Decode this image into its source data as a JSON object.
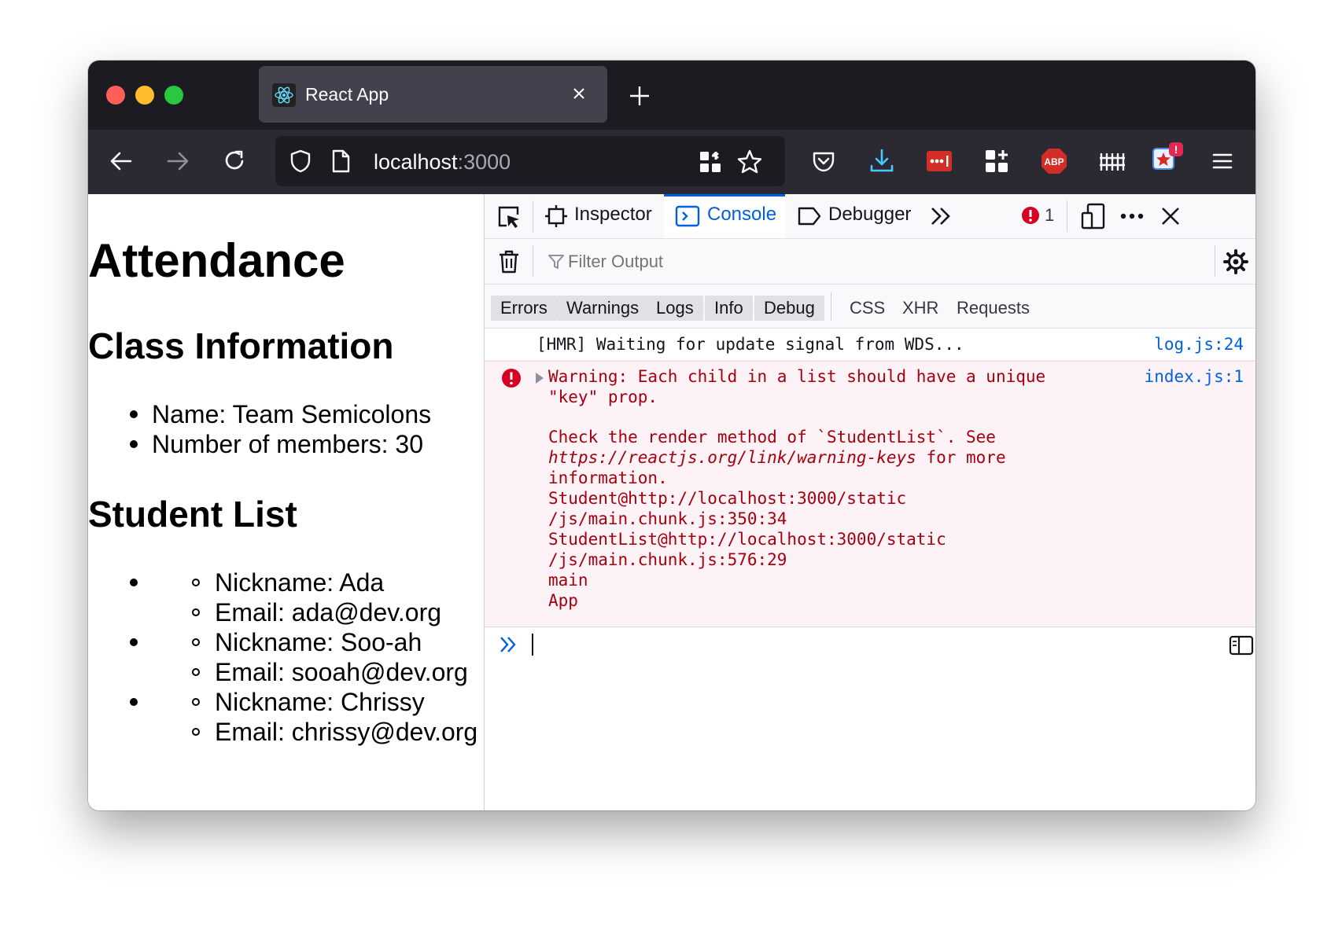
{
  "browser": {
    "tab": {
      "title": "React App"
    },
    "url": {
      "host": "localhost",
      "port": ":3000"
    }
  },
  "page": {
    "heading": "Attendance",
    "class_section": {
      "title": "Class Information",
      "items": [
        "Name: Team Semicolons",
        "Number of members: 30"
      ]
    },
    "students_section": {
      "title": "Student List",
      "students": [
        {
          "nickname": "Nickname: Ada",
          "email": "Email: ada@dev.org"
        },
        {
          "nickname": "Nickname: Soo-ah",
          "email": "Email: sooah@dev.org"
        },
        {
          "nickname": "Nickname: Chrissy",
          "email": "Email: chrissy@dev.org"
        }
      ]
    }
  },
  "devtools": {
    "tabs": {
      "inspector": "Inspector",
      "console": "Console",
      "debugger": "Debugger"
    },
    "error_count": "1",
    "filter_placeholder": "Filter Output",
    "filters": [
      "Errors",
      "Warnings",
      "Logs",
      "Info",
      "Debug"
    ],
    "extra_filters": [
      "CSS",
      "XHR",
      "Requests"
    ],
    "messages": [
      {
        "type": "log",
        "text": "[HMR] Waiting for update signal from WDS...",
        "source": "log.js:24"
      },
      {
        "type": "error",
        "source": "index.js:1",
        "lines": [
          "Warning: Each child in a list should have a unique",
          "\"key\" prop.",
          "",
          "Check the render method of `StudentList`. See",
          "https://reactjs.org/link/warning-keys for more",
          "information.",
          "Student@http://localhost:3000/static",
          "/js/main.chunk.js:350:34",
          "StudentList@http://localhost:3000/static",
          "/js/main.chunk.js:576:29",
          "main",
          "App"
        ],
        "link_text": "https://reactjs.org/link/warning-keys",
        "link_suffix": " for more"
      }
    ]
  },
  "colors": {
    "accent": "#0060df",
    "error": "#a4000f",
    "error_bg": "#fdf2f5",
    "titlebar": "#1c1b22",
    "toolbar": "#2b2a33"
  }
}
